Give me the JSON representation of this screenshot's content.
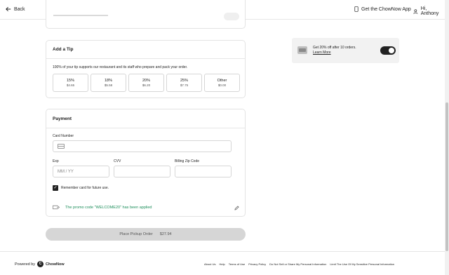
{
  "header": {
    "back_label": "Back",
    "get_app_label": "Get the ChowNow App",
    "user_label": "Hi, Anthony"
  },
  "tip": {
    "title": "Add a Tip",
    "description": "100% of your tip supports our restaurant and its staff who prepare and pack your order.",
    "options": [
      {
        "pct": "15%",
        "amount": "$4.65"
      },
      {
        "pct": "18%",
        "amount": "$5.58"
      },
      {
        "pct": "20%",
        "amount": "$6.20"
      },
      {
        "pct": "25%",
        "amount": "$7.75"
      },
      {
        "pct": "Other",
        "amount": "$0.00"
      }
    ]
  },
  "payment": {
    "title": "Payment",
    "card_number_label": "Card Number",
    "exp_label": "Exp",
    "exp_placeholder": "MM / YY",
    "cvv_label": "CVV",
    "zip_label": "Billing Zip Code",
    "remember_label": "Remember card for future use.",
    "promo_message": "The promo code \"WELCOME20\" has been applied"
  },
  "order": {
    "place_label": "Place Pickup Order",
    "total": "$27.94"
  },
  "promo_box": {
    "text": "Get 20% off after 10 orders.",
    "link": "Learn More"
  },
  "footer": {
    "powered_by": "Powered by",
    "logo_text": "ChowNow",
    "links": [
      "About Us",
      "Help",
      "Terms of Use",
      "Privacy Policy",
      "Do Not Sell or Share My Personal Information",
      "Limit The Use Of My Sensitive Personal Information"
    ]
  }
}
